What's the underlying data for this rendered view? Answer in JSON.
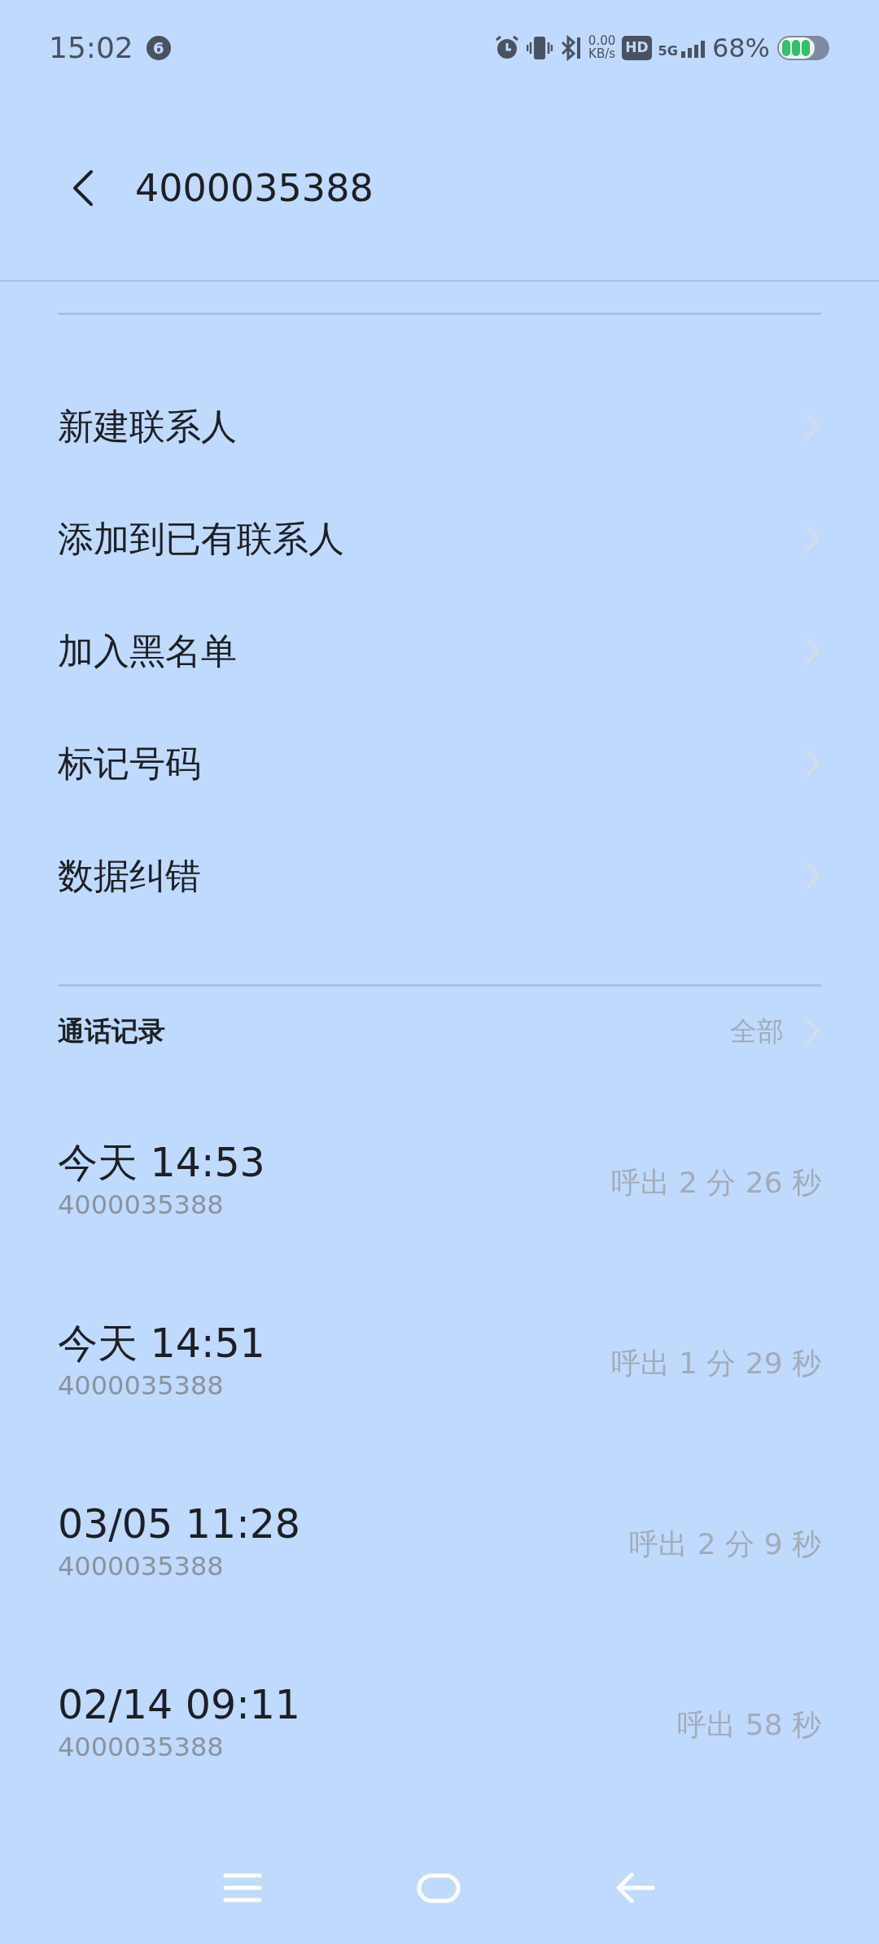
{
  "status_bar": {
    "time": "15:02",
    "notification_count": "6",
    "net_speed": "0.00",
    "net_unit": "KB/s",
    "hd": "HD",
    "network": "5G",
    "battery": "68%"
  },
  "header": {
    "title": "4000035388"
  },
  "actions": [
    {
      "label": "新建联系人"
    },
    {
      "label": "添加到已有联系人"
    },
    {
      "label": "加入黑名单"
    },
    {
      "label": "标记号码"
    },
    {
      "label": "数据纠错"
    }
  ],
  "call_log": {
    "title": "通话记录",
    "all_link": "全部",
    "entries": [
      {
        "time": "今天 14:53",
        "number": "4000035388",
        "detail": "呼出 2 分 26 秒"
      },
      {
        "time": "今天 14:51",
        "number": "4000035388",
        "detail": "呼出 1 分 29 秒"
      },
      {
        "time": "03/05 11:28",
        "number": "4000035388",
        "detail": "呼出 2 分 9 秒"
      },
      {
        "time": "02/14 09:11",
        "number": "4000035388",
        "detail": "呼出 58 秒"
      }
    ]
  }
}
